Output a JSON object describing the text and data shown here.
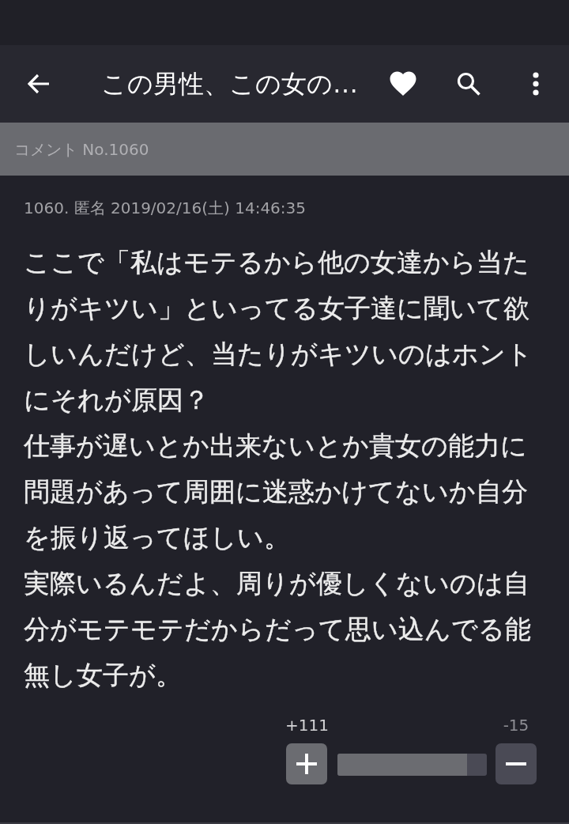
{
  "app_bar": {
    "title": "この男性、この女の…"
  },
  "section_header": {
    "label": "コメント No.1060"
  },
  "comment": {
    "meta": "1060. 匿名 2019/02/16(土) 14:46:35",
    "paragraphs": [
      "ここで「私はモテるから他の女達から当たりがキツい」といってる女子達に聞いて欲しいんだけど、当たりがキツいのはホントにそれが原因？",
      "仕事が遅いとか出来ないとか貴女の能力に問題があって周囲に迷惑かけてないか自分を振り返ってほしい。",
      "実際いるんだよ、周りが優しくないのは自分がモテモテだからだって思い込んでる能無し女子が。"
    ],
    "votes": {
      "plus_count": "+111",
      "minus_count": "-15",
      "level": 0.87
    }
  }
}
